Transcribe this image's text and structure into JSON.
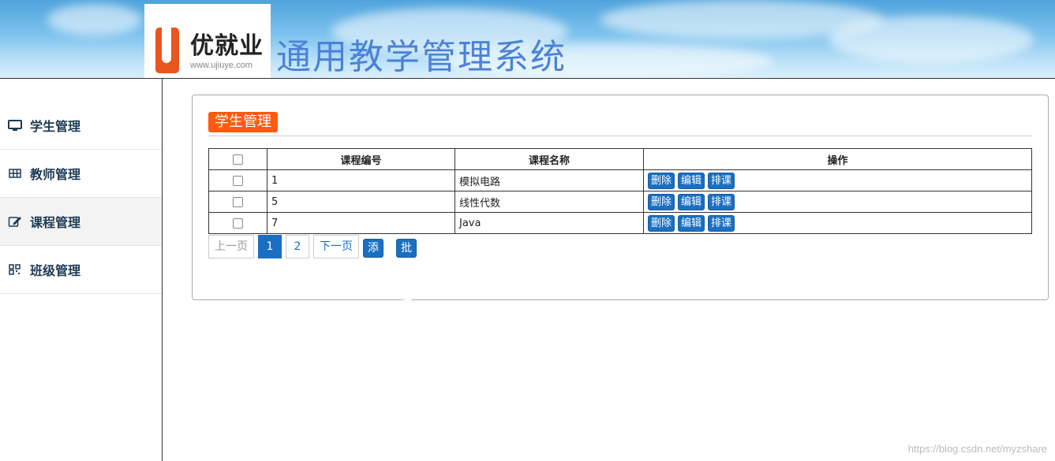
{
  "header": {
    "logo_name": "优就业",
    "logo_url": "www.ujiuye.com",
    "system_title": "通用教学管理系统"
  },
  "sidebar": {
    "items": [
      {
        "label": "学生管理",
        "icon": "monitor-icon"
      },
      {
        "label": "教师管理",
        "icon": "grid-icon"
      },
      {
        "label": "课程管理",
        "icon": "edit-icon",
        "active": true
      },
      {
        "label": "班级管理",
        "icon": "qrcode-icon"
      }
    ]
  },
  "main": {
    "section_title": "学生管理",
    "table": {
      "headers": [
        "课程编号",
        "课程名称",
        "操作"
      ],
      "rows": [
        {
          "id": "1",
          "name": "模拟电路"
        },
        {
          "id": "5",
          "name": "线性代数"
        },
        {
          "id": "7",
          "name": "Java"
        }
      ],
      "actions": {
        "delete": "删除",
        "edit": "编辑",
        "schedule": "排课"
      }
    },
    "pager": {
      "prev": "上一页",
      "pages": [
        "1",
        "2"
      ],
      "current": "1",
      "next": "下一页",
      "add": "添加",
      "batch_delete": "批量删除"
    }
  },
  "watermark": "https://blog.csdn.net/myzshare",
  "colors": {
    "accent_blue": "#1a6fc2",
    "title_orange": "#ff5a0f",
    "system_title": "#4c82d6"
  }
}
